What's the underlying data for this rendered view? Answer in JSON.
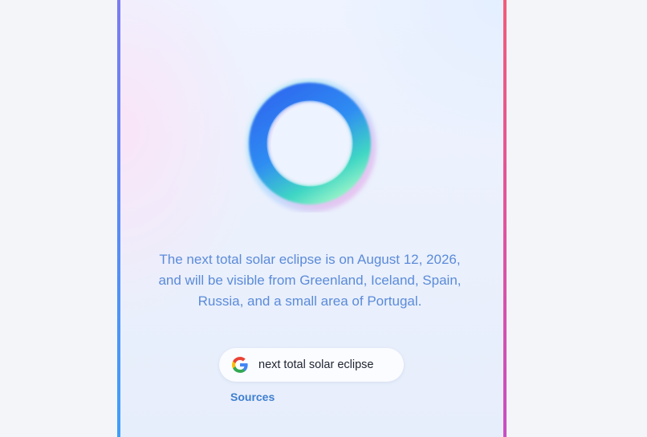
{
  "assistant": {
    "answer_text": "The next total solar eclipse is on August 12, 2026, and will be visible from Greenland, Iceland, Spain, Russia, and a small area of Portugal.",
    "search_chip": {
      "icon": "google-g-icon",
      "label": "next total solar eclipse"
    },
    "sources_label": "Sources"
  },
  "colors": {
    "answer_text": "#5b8bd9",
    "sources_link": "#3f7fd0",
    "left_edge": "#5f86f5",
    "right_edge": "#e5539a",
    "page_background": "#f4f5f8"
  }
}
